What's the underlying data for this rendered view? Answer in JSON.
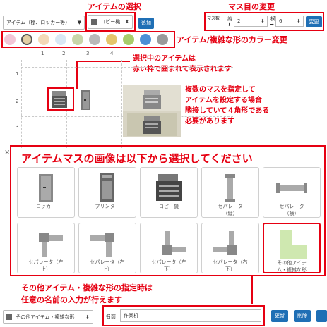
{
  "annotations": {
    "item_select": "アイテムの選択",
    "grid_change": "マス目の変更",
    "color_change": "アイテム/複雑な形のカラー変更",
    "selected_note_1": "選択中のアイテムは",
    "selected_note_2": "赤い枠で囲まれて表示されます",
    "multi_note_1": "複数のマスを指定して",
    "multi_note_2": "アイテムを設定する場合",
    "multi_note_3": "隣接していて４角形である",
    "multi_note_4": "必要があります",
    "tile_header": "アイテムマスの画像は以下から選択してください",
    "other_note_1": "その他アイテム・複雑な形の指定時は",
    "other_note_2": "任意の名前の入力が行えます"
  },
  "toolbar": {
    "category_select": "アイテム（棚、ロッカー等）",
    "item_select": "コピー機",
    "add_button": "追加",
    "rows_label": "マス数",
    "rows_sub": "縦",
    "rows_value": "2",
    "cols_sub": "横",
    "cols_value": "6",
    "change_button": "変更"
  },
  "colors": [
    "#f2c5d6",
    "#e3cfa4",
    "#f3d9b8",
    "#d9e8f5",
    "#c8d6a9",
    "#b9b9b9",
    "#e4c56b",
    "#a8cc6a",
    "#4b8fd6",
    "#9a9a9a"
  ],
  "grid": {
    "col_labels": [
      "1",
      "2",
      "3",
      "4"
    ],
    "row_labels": [
      "1",
      "2",
      "3"
    ]
  },
  "tiles": [
    {
      "label": "ロッカー",
      "icon": "locker-icon"
    },
    {
      "label": "プリンター",
      "icon": "printer-icon"
    },
    {
      "label": "コピー機",
      "icon": "copier-icon"
    },
    {
      "label": "セパレータ\n（縦）",
      "icon": "separator-vertical-icon"
    },
    {
      "label": "セパレータ\n（横）",
      "icon": "separator-horizontal-icon"
    },
    {
      "label": "セパレータ（左\n上）",
      "icon": "separator-top-left-icon"
    },
    {
      "label": "セパレータ（右\n上）",
      "icon": "separator-top-right-icon"
    },
    {
      "label": "セパレータ（左\n下）",
      "icon": "separator-bottom-left-icon"
    },
    {
      "label": "セパレータ（右\n下）",
      "icon": "separator-bottom-right-icon"
    },
    {
      "label": "その他アイテ\nム・複雑な形",
      "icon": "other-shape-icon"
    }
  ],
  "bottom_bar": {
    "type_select": "その他アイテム・複雑な形",
    "name_label": "名前",
    "name_value": "作業机",
    "update_button": "更新",
    "delete_button": "削除"
  }
}
